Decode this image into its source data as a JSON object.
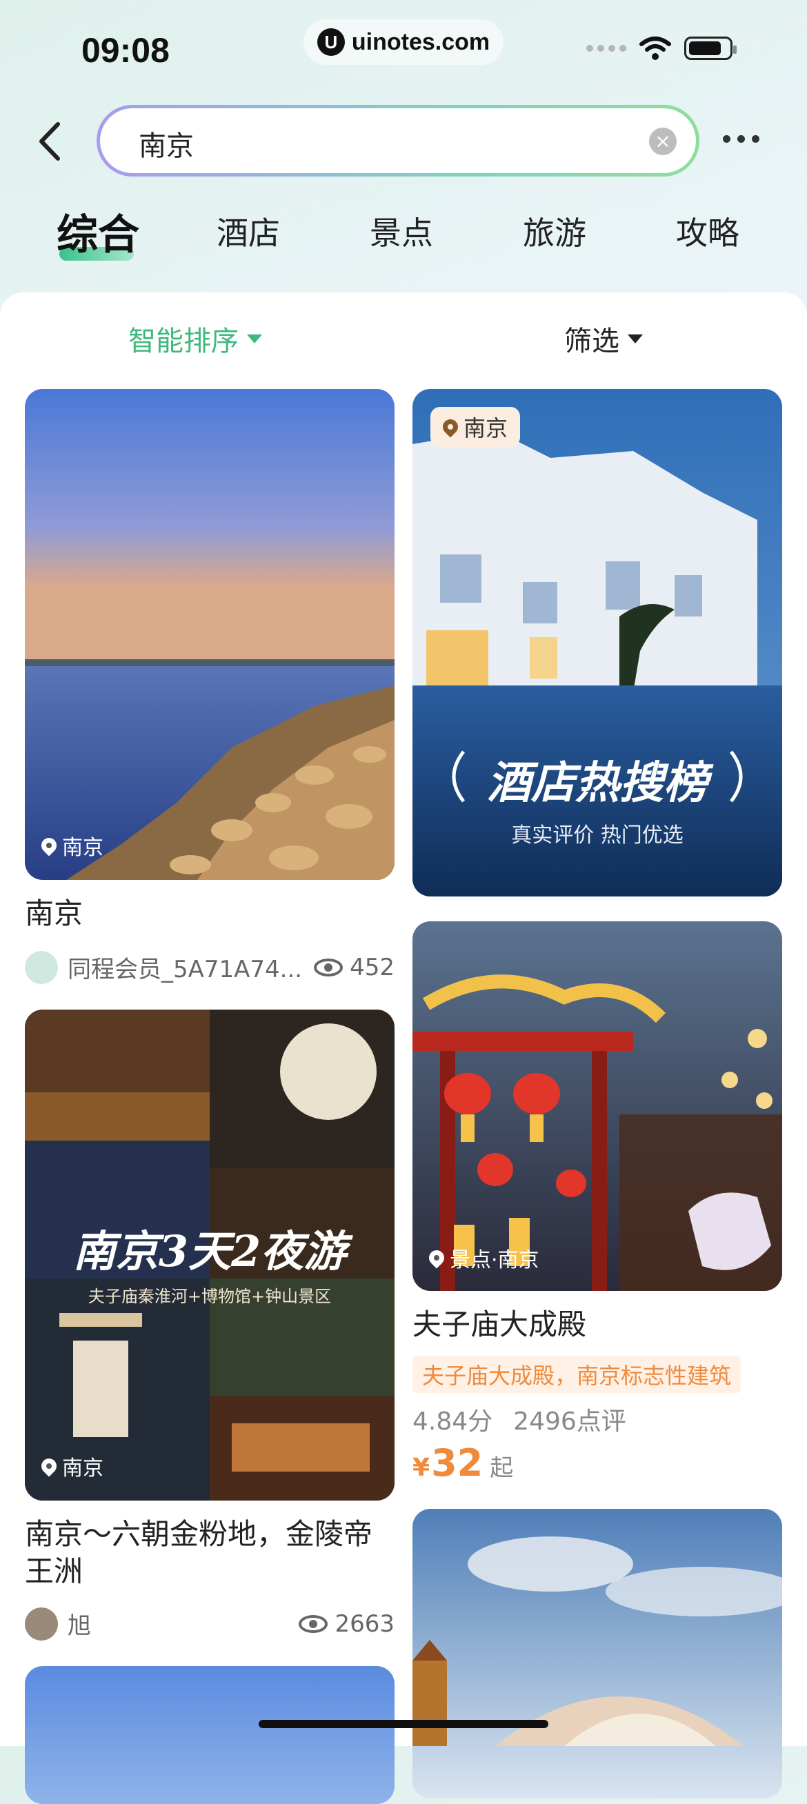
{
  "status_bar": {
    "time": "09:08",
    "url": "uinotes.com",
    "logo_letter": "U"
  },
  "search": {
    "value": "南京",
    "clear_icon": "×"
  },
  "tabs": [
    {
      "label": "综合",
      "active": true
    },
    {
      "label": "酒店"
    },
    {
      "label": "景点"
    },
    {
      "label": "旅游"
    },
    {
      "label": "攻略"
    }
  ],
  "sort": {
    "label": "智能排序",
    "filter_label": "筛选"
  },
  "cards": {
    "left1": {
      "location": "南京",
      "title": "南京",
      "author": "同程会员_5A71A74...",
      "views": "452"
    },
    "left2": {
      "location": "南京",
      "overlay_title": "南京3天2夜游",
      "overlay_sub": "夫子庙秦淮河+博物馆+钟山景区",
      "title": "南京～六朝金粉地，金陵帝王洲",
      "author": "旭",
      "views": "2663"
    },
    "right1": {
      "location": "南京",
      "banner_title": "酒店热搜榜",
      "banner_sub": "真实评价 热门优选"
    },
    "right2": {
      "location": "景点·南京",
      "title": "夫子庙大成殿",
      "tag": "夫子庙大成殿，南京标志性建筑",
      "score": "4.84分",
      "reviews": "2496点评",
      "currency": "¥",
      "price": "32",
      "price_suffix": "起"
    }
  },
  "colors": {
    "accent_green": "#3fb87d",
    "price_orange": "#f08a3c"
  }
}
